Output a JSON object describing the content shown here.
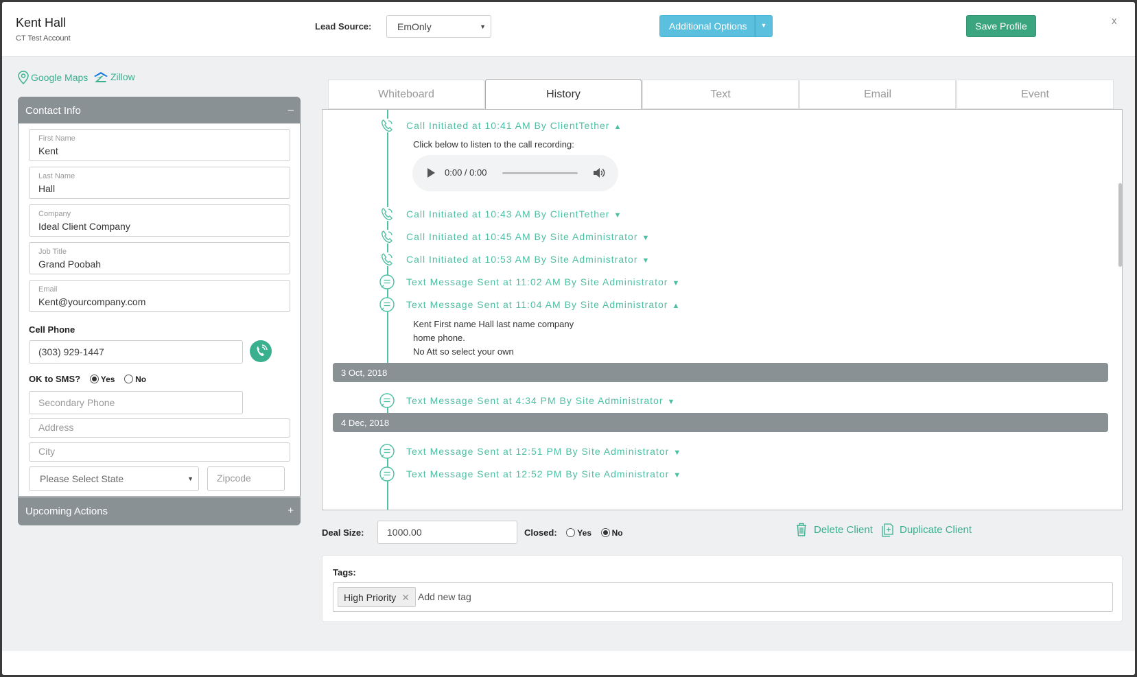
{
  "header": {
    "name": "Kent Hall",
    "account": "CT Test Account",
    "lead_source_label": "Lead Source:",
    "lead_source_value": "EmOnly",
    "additional_options": "Additional Options",
    "save_profile": "Save Profile",
    "close": "x"
  },
  "links": {
    "google_maps": "Google Maps",
    "zillow": "Zillow"
  },
  "contact": {
    "title": "Contact Info",
    "collapse_sign": "–",
    "fields": [
      {
        "label": "First Name",
        "value": "Kent"
      },
      {
        "label": "Last Name",
        "value": "Hall"
      },
      {
        "label": "Company",
        "value": "Ideal Client Company"
      },
      {
        "label": "Job Title",
        "value": "Grand Poobah"
      },
      {
        "label": "Email",
        "value": "Kent@yourcompany.com"
      }
    ],
    "cell_phone_label": "Cell Phone",
    "cell_phone_value": "(303) 929-1447",
    "sms_label": "OK to SMS?",
    "sms_yes": "Yes",
    "sms_no": "No",
    "sms_selected": "Yes",
    "secondary_phone_placeholder": "Secondary Phone",
    "address_placeholder": "Address",
    "city_placeholder": "City",
    "state_placeholder": "Please Select State",
    "zip_placeholder": "Zipcode"
  },
  "upcoming": {
    "title": "Upcoming Actions",
    "expand_sign": "+"
  },
  "tabs": [
    "Whiteboard",
    "History",
    "Text",
    "Email",
    "Event"
  ],
  "active_tab": "History",
  "history": {
    "entries": [
      {
        "type": "call",
        "text": "Call Initiated at 10:41 AM By ClientTether",
        "chevron": "up"
      },
      {
        "type": "call",
        "text": "Call Initiated at 10:43 AM By ClientTether",
        "chevron": "down"
      },
      {
        "type": "call",
        "text": "Call Initiated at 10:45 AM By Site Administrator",
        "chevron": "down"
      },
      {
        "type": "call",
        "text": "Call Initiated at 10:53 AM By Site Administrator",
        "chevron": "down"
      },
      {
        "type": "text",
        "text": "Text Message Sent at 11:02 AM By Site Administrator",
        "chevron": "down"
      },
      {
        "type": "text",
        "text": "Text Message Sent at 11:04 AM By Site Administrator",
        "chevron": "up"
      },
      {
        "type": "text",
        "text": "Text Message Sent at 4:34 PM By Site Administrator",
        "chevron": "down"
      },
      {
        "type": "text",
        "text": "Text Message Sent at 12:51 PM By Site Administrator",
        "chevron": "down"
      },
      {
        "type": "text",
        "text": "Text Message Sent at 12:52 PM By Site Administrator",
        "chevron": "down"
      }
    ],
    "recording_prompt": "Click below to listen to the call recording:",
    "audio_time": "0:00 / 0:00",
    "message_lines": [
      "Kent First name Hall last name company",
      "home phone.",
      "No Att so select your own"
    ],
    "dates": [
      "3 Oct, 2018",
      "4 Dec, 2018"
    ]
  },
  "deal": {
    "deal_size_label": "Deal Size:",
    "deal_size_value": "1000.00",
    "closed_label": "Closed:",
    "closed_yes": "Yes",
    "closed_no": "No",
    "closed_selected": "No",
    "delete_client": "Delete Client",
    "duplicate_client": "Duplicate Client"
  },
  "tags": {
    "label": "Tags:",
    "items": [
      "High Priority"
    ],
    "placeholder": "Add new tag"
  },
  "colors": {
    "accent": "#3ab08f",
    "info": "#5bc0de",
    "panel": "#8a9195",
    "timeline": "#4fc1a5"
  }
}
